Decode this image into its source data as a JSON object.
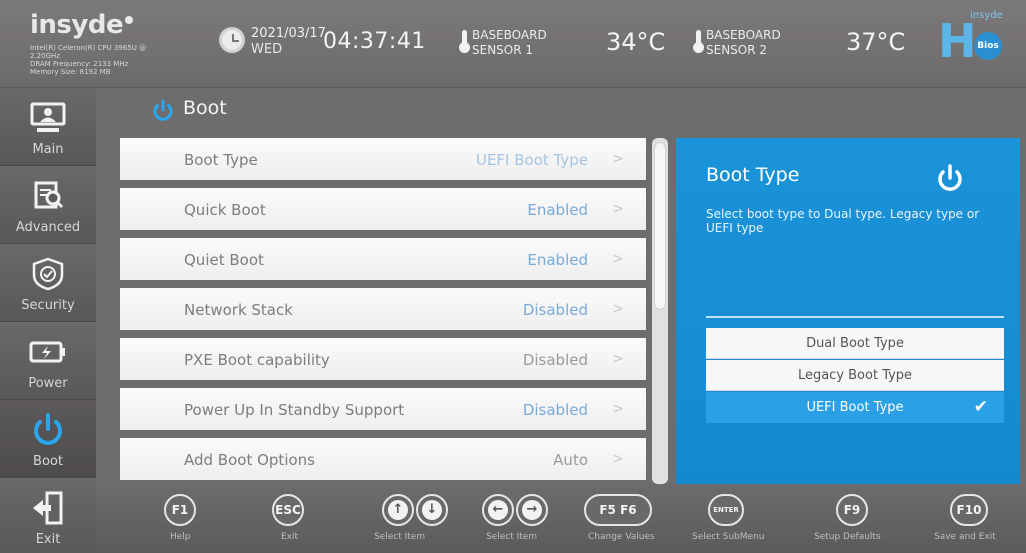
{
  "header": {
    "logo": "insyde",
    "sysinfo": [
      "Intel(R) Celeron(R) CPU 3965U @",
      "2.20GHz",
      "DRAM Frequency: 2133 MHz",
      "Memory Size: 8192 MB"
    ],
    "date": "2021/03/17",
    "weekday": "WED",
    "time": "04:37:41",
    "sensor1": {
      "line1": "BASEBOARD",
      "line2": "SENSOR 1",
      "temp": "34°C"
    },
    "sensor2": {
      "line1": "BASEBOARD",
      "line2": "SENSOR 2",
      "temp": "37°C"
    },
    "brand_h": "H",
    "brand_insyde": "insyde",
    "brand_badge": "Bios"
  },
  "nav": {
    "items": [
      {
        "label": "Main",
        "icon": "monitor-user-icon"
      },
      {
        "label": "Advanced",
        "icon": "magnify-settings-icon"
      },
      {
        "label": "Security",
        "icon": "shield-check-icon"
      },
      {
        "label": "Power",
        "icon": "battery-charge-icon"
      },
      {
        "label": "Boot",
        "icon": "power-icon"
      },
      {
        "label": "Exit",
        "icon": "exit-door-icon"
      }
    ],
    "active": "Boot"
  },
  "page": {
    "title": "Boot"
  },
  "settings": [
    {
      "label": "Boot Type",
      "value": "UEFI Boot Type",
      "chevron": ">"
    },
    {
      "label": "Quick Boot",
      "value": "Enabled",
      "chevron": ">"
    },
    {
      "label": "Quiet Boot",
      "value": "Enabled",
      "chevron": ">"
    },
    {
      "label": "Network Stack",
      "value": "Disabled",
      "chevron": ">"
    },
    {
      "label": "PXE Boot capability",
      "value": "Disabled",
      "chevron": ">"
    },
    {
      "label": "Power Up In Standby Support",
      "value": "Disabled",
      "chevron": ">"
    },
    {
      "label": "Add Boot Options",
      "value": "Auto",
      "chevron": ">"
    }
  ],
  "help": {
    "title": "Boot Type",
    "description": "Select boot type to Dual type. Legacy type or UEFI type",
    "options": [
      "Dual Boot Type",
      "Legacy Boot Type",
      "UEFI Boot Type"
    ],
    "selected_index": 2,
    "check": "✔"
  },
  "footer": {
    "keys": [
      {
        "key": "F1",
        "label": "Help"
      },
      {
        "key": "ESC",
        "label": "Exit"
      },
      {
        "key": "↑↓",
        "label": "Select Item"
      },
      {
        "key": "←→",
        "label": "Select Item"
      },
      {
        "key": "F5 F6",
        "label": "Change Values"
      },
      {
        "key": "ENTER",
        "label": "Select  SubMenu"
      },
      {
        "key": "F9",
        "label": "Setup Defaults"
      },
      {
        "key": "F10",
        "label": "Save and Exit"
      }
    ]
  },
  "colors": {
    "accent": "#1b93d8",
    "value_enabled": "#7aaad8",
    "value_disabled": "#9a9a9a",
    "background": "#6f6c6e"
  }
}
